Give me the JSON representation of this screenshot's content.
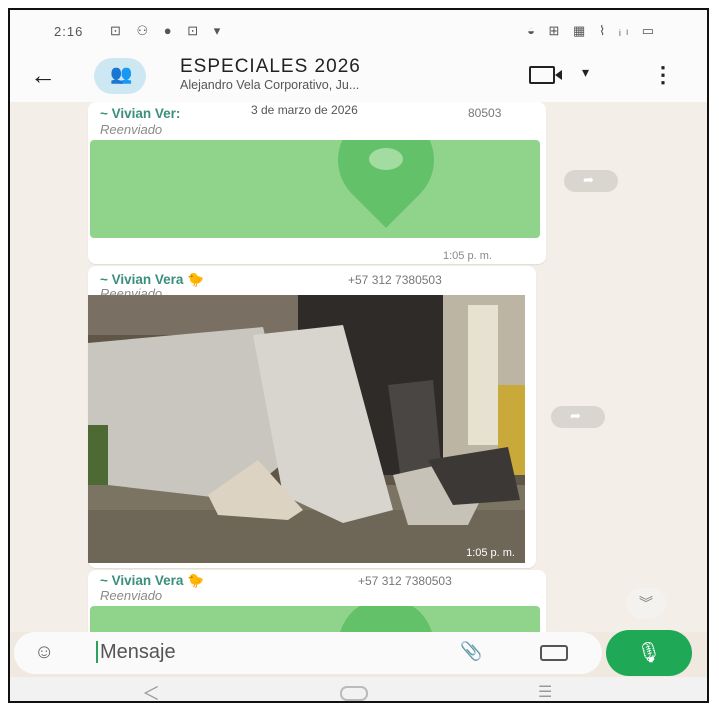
{
  "statusbar": {
    "time": "2:16",
    "left_icons": "⊡ ⚇ ● ⊡ ▾",
    "right_icons": "◒ ⊞ ▦ ⌇ ᵢₗ ▭"
  },
  "header": {
    "title": "ESPECIALES 2026",
    "subtitle": "Alejandro Vela Corporativo, Ju..."
  },
  "messages": [
    {
      "sender": "~ Vivian Ver:",
      "date": "3 de marzo de 2026",
      "phone": "80503",
      "forwarded": "Reenviado",
      "time": "1:05 p. m."
    },
    {
      "sender": "~ Vivian Vera 🐤",
      "phone": "+57 312 7380503",
      "forwarded": "Reenviado",
      "time": "1:05 p. m."
    },
    {
      "sender": "~ Vivian Vera 🐤",
      "phone": "+57 312 7380503",
      "forwarded": "Reenviado"
    }
  ],
  "compose": {
    "placeholder": "Mensaje"
  },
  "icons": {
    "back": "arrow-left-icon",
    "video": "video-call-icon",
    "menu": "more-vertical-icon",
    "mic": "mic-icon"
  },
  "colors": {
    "accent": "#1fa855",
    "map": "#8fd48a",
    "sender": "#3a8f7a"
  }
}
